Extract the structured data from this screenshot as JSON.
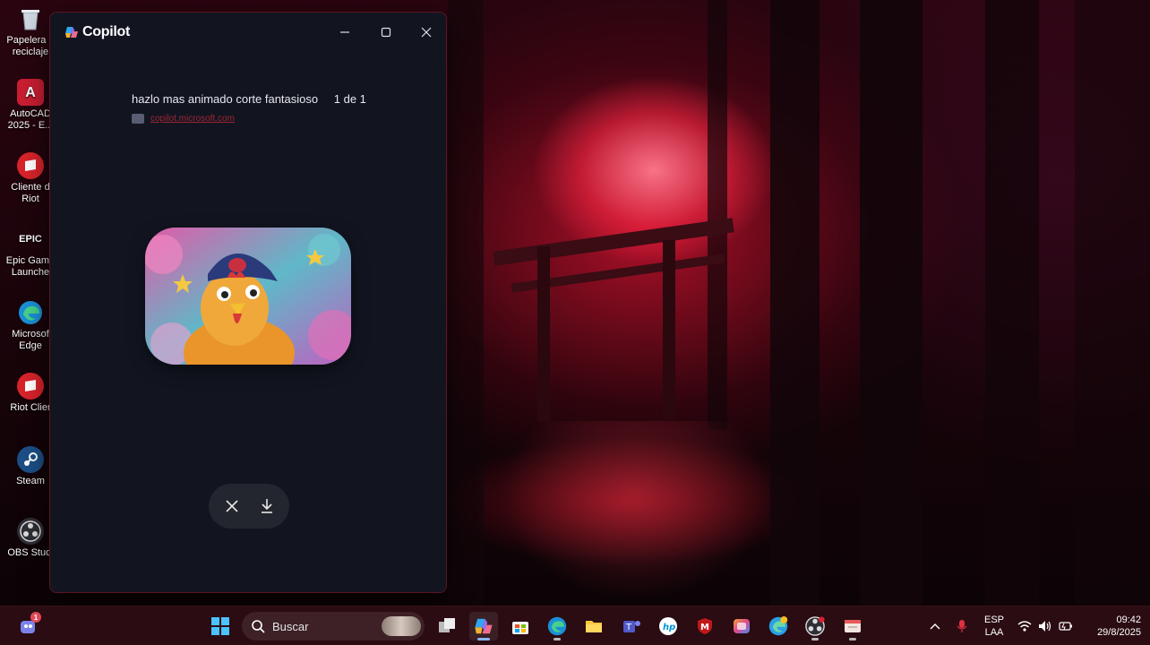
{
  "desktop": {
    "icons": [
      {
        "label": "Papelera de reciclaje",
        "short": "Papelera d\nreciclaje"
      },
      {
        "label": "AutoCAD 2025 - E...",
        "short": "AutoCAD\n2025 - E..."
      },
      {
        "label": "Cliente de Riot",
        "short": "Cliente d\nRiot"
      },
      {
        "label": "Epic Games Launcher",
        "short": "Epic Game\nLaunche"
      },
      {
        "label": "Microsoft Edge",
        "short": "Microsof\nEdge"
      },
      {
        "label": "Riot Client",
        "short": "Riot Clier"
      },
      {
        "label": "Steam",
        "short": "Steam"
      },
      {
        "label": "OBS Studio",
        "short": "OBS Studi"
      }
    ]
  },
  "copilot": {
    "title": "Copilot",
    "prompt": "hazlo mas animado corte fantasioso",
    "count": "1 de 1",
    "source": "copilot.microsoft.com"
  },
  "taskbar": {
    "search_placeholder": "Buscar",
    "language": "ESP",
    "region": "LAA",
    "time": "09:42",
    "date": "29/8/2025",
    "notification_count": "1"
  },
  "colors": {
    "window_bg": "#121520",
    "taskbar_bg": "#2a0c12",
    "accent_red": "#c02a3a"
  }
}
